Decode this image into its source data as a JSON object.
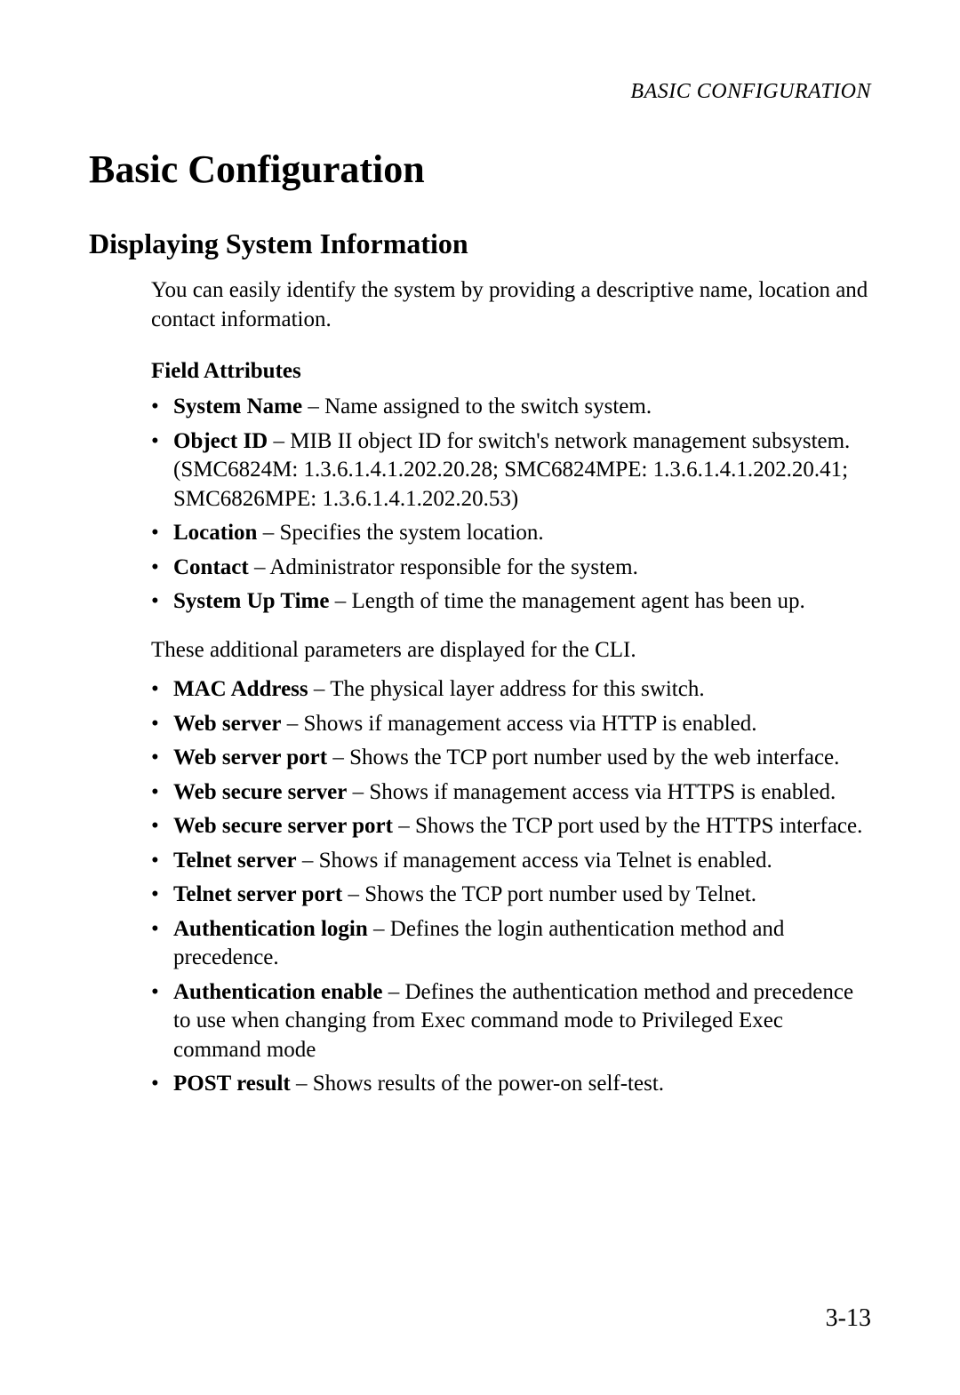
{
  "runningHeader": "BASIC CONFIGURATION",
  "h1": "Basic Configuration",
  "h2": "Displaying System Information",
  "intro": "You can easily identify the system by providing a descriptive name, location and contact information.",
  "h3": "Field Attributes",
  "list1": [
    {
      "term": "System Name",
      "desc": " – Name assigned to the switch system."
    },
    {
      "term": "Object ID",
      "desc": " – MIB II object ID for switch's network management subsystem. (SMC6824M: 1.3.6.1.4.1.202.20.28; SMC6824MPE: 1.3.6.1.4.1.202.20.41; SMC6826MPE: 1.3.6.1.4.1.202.20.53)"
    },
    {
      "term": "Location",
      "desc": " – Specifies the system location."
    },
    {
      "term": "Contact",
      "desc": " – Administrator responsible for the system."
    },
    {
      "term": "System Up Time",
      "desc": " – Length of time the management agent has been up."
    }
  ],
  "midPara": "These additional parameters are displayed for the CLI.",
  "list2": [
    {
      "term": "MAC Address",
      "desc": " – The physical layer address for this switch."
    },
    {
      "term": "Web server",
      "desc": " – Shows if management access via HTTP is enabled."
    },
    {
      "term": "Web server port",
      "desc": " – Shows the TCP port number used by the web interface."
    },
    {
      "term": "Web secure server",
      "desc": " – Shows if management access via HTTPS is enabled."
    },
    {
      "term": "Web secure server port",
      "desc": " – Shows the TCP port used by the HTTPS interface."
    },
    {
      "term": "Telnet server",
      "desc": " – Shows if management access via Telnet is enabled."
    },
    {
      "term": "Telnet server port",
      "desc": " – Shows the TCP port number used by Telnet."
    },
    {
      "term": "Authentication login",
      "desc": " – Defines the login authentication method and precedence."
    },
    {
      "term": "Authentication enable",
      "desc": " – Defines the authentication method and precedence to use when changing from Exec command mode to Privileged Exec command mode"
    },
    {
      "term": "POST result",
      "desc": " – Shows results of the power-on self-test."
    }
  ],
  "pageNumber": "3-13"
}
